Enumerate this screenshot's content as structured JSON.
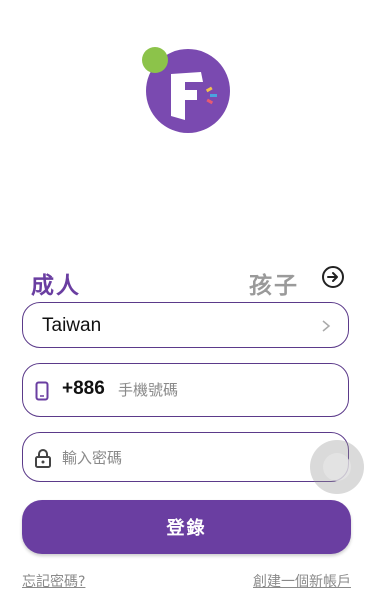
{
  "logo": {
    "name": "app-logo",
    "colors": {
      "circle": "#7a4ab0",
      "dot": "#8cc34a",
      "mark": "#ffffff"
    }
  },
  "tabs": {
    "adult": "成人",
    "child": "孩子"
  },
  "arrow_icon": "arrow-right-circle-icon",
  "country": {
    "value": "Taiwan"
  },
  "phone": {
    "code": "+886",
    "placeholder": "手機號碼"
  },
  "password": {
    "placeholder": "輸入密碼"
  },
  "login_button": "登錄",
  "links": {
    "forgot": "忘記密碼?",
    "create": "創建一個新帳戶"
  },
  "colors": {
    "accent": "#6a3ea1",
    "border": "#5b3a8a",
    "inactive": "#9a9a9a"
  }
}
